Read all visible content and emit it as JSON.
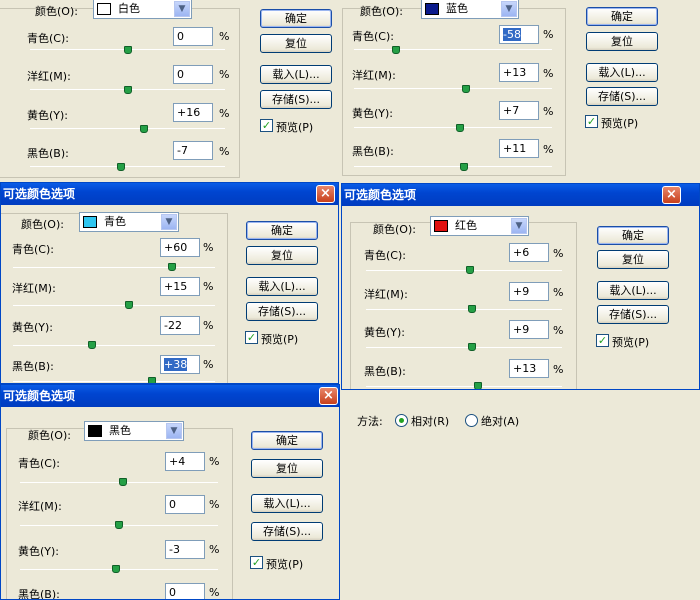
{
  "common": {
    "dialog_title": "可选颜色选项",
    "colors_label": "颜色(O):",
    "ok": "确定",
    "reset": "复位",
    "load": "载入(L)...",
    "save": "存储(S)...",
    "preview": "预览(P)",
    "cyan": "青色(C):",
    "magenta": "洋红(M):",
    "yellow": "黄色(Y):",
    "black": "黑色(B):",
    "percent": "%",
    "close": "×"
  },
  "panels": [
    {
      "color_name": "白色",
      "swatch": "#ffffff",
      "values": {
        "cyan": "0",
        "magenta": "0",
        "yellow": "+16",
        "black": "-7"
      }
    },
    {
      "color_name": "蓝色",
      "swatch": "#0a1a8c",
      "values": {
        "cyan": "-58",
        "magenta": "+13",
        "yellow": "+7",
        "black": "+11"
      }
    },
    {
      "color_name": "青色",
      "swatch": "#2fc6f0",
      "values": {
        "cyan": "+60",
        "magenta": "+15",
        "yellow": "-22",
        "black": "+38"
      }
    },
    {
      "color_name": "红色",
      "swatch": "#e01010",
      "values": {
        "cyan": "+6",
        "magenta": "+9",
        "yellow": "+9",
        "black": "+13"
      }
    },
    {
      "color_name": "黑色",
      "swatch": "#000000",
      "values": {
        "cyan": "+4",
        "magenta": "0",
        "yellow": "-3",
        "black": "0"
      }
    }
  ],
  "method": {
    "label": "方法:",
    "relative": "相对(R)",
    "absolute": "绝对(A)",
    "selected": "relative"
  }
}
